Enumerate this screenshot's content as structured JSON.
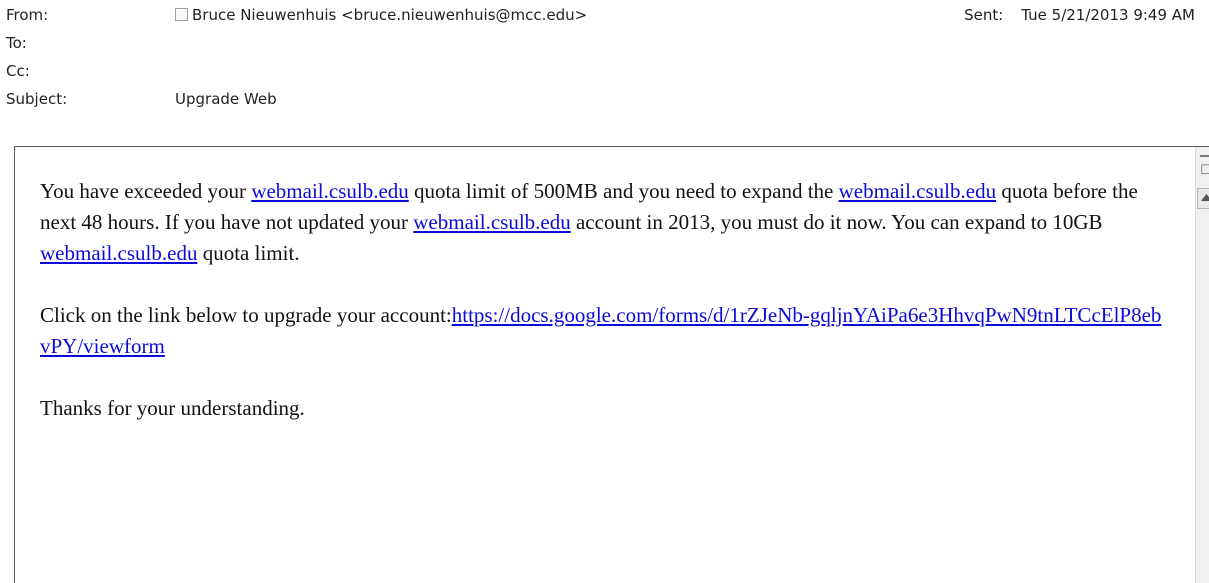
{
  "header": {
    "from_label": "From:",
    "from_value": "Bruce Nieuwenhuis <bruce.nieuwenhuis@mcc.edu>",
    "sent_label": "Sent:",
    "sent_value": "Tue 5/21/2013 9:49 AM",
    "to_label": "To:",
    "cc_label": "Cc:",
    "subject_label": "Subject:",
    "subject_value": "Upgrade Web"
  },
  "body": {
    "p1_t1": "You have exceeded your ",
    "p1_link1": "webmail.csulb.edu",
    "p1_t2": " quota limit of 500MB and you need to expand the ",
    "p1_link2": "webmail.csulb.edu",
    "p1_t3": " quota before the next 48 hours. If you have not updated your ",
    "p1_link3": "webmail.csulb.edu",
    "p1_t4": " account in 2013, you must do it now. You can expand to 10GB ",
    "p1_link4": "webmail.csulb.edu",
    "p1_t5": " quota limit.",
    "p2_t1": "Click on the link below to upgrade your account:",
    "p2_link": "https://docs.google.com/forms/d/1rZJeNb-gqljnYAiPa6e3HhvqPwN9tnLTCcElP8ebvPY/viewform",
    "p3": "Thanks for your understanding."
  }
}
